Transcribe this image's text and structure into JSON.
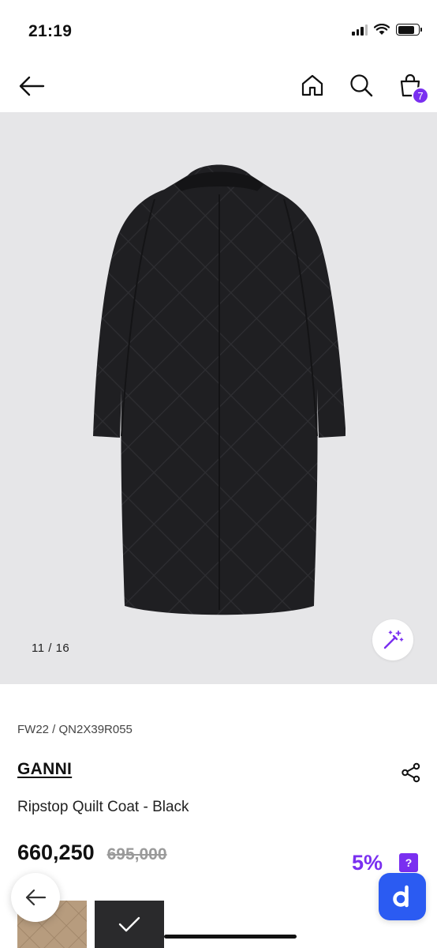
{
  "status_bar": {
    "time": "21:19",
    "icons": [
      "signal-icon",
      "wifi-icon",
      "battery-icon"
    ]
  },
  "nav": {
    "icons": [
      "back-arrow-icon",
      "home-icon",
      "search-icon",
      "shopping-bag-icon"
    ],
    "cart_count": "7"
  },
  "gallery": {
    "counter": "11 / 16",
    "current": 11,
    "total": 16,
    "magic_icon": "magic-wand-icon",
    "background_color": "#e6e6e8"
  },
  "product": {
    "season_code": "FW22 / QN2X39R055",
    "brand": "GANNI",
    "name": "Ripstop Quilt Coat - Black",
    "price_current": "660,250",
    "price_original": "695,000",
    "discount": "5%",
    "discount_help": "?",
    "share_icon": "share-icon"
  },
  "floating": {
    "back_icon": "back-arrow-icon",
    "app_fab_label": "d",
    "thumb_check_icon": "check-icon"
  },
  "colors": {
    "accent_purple": "#7a2ff0",
    "fab_blue": "#2b5bf2",
    "text_primary": "#111111",
    "strike_gray": "#9a9a9a"
  }
}
